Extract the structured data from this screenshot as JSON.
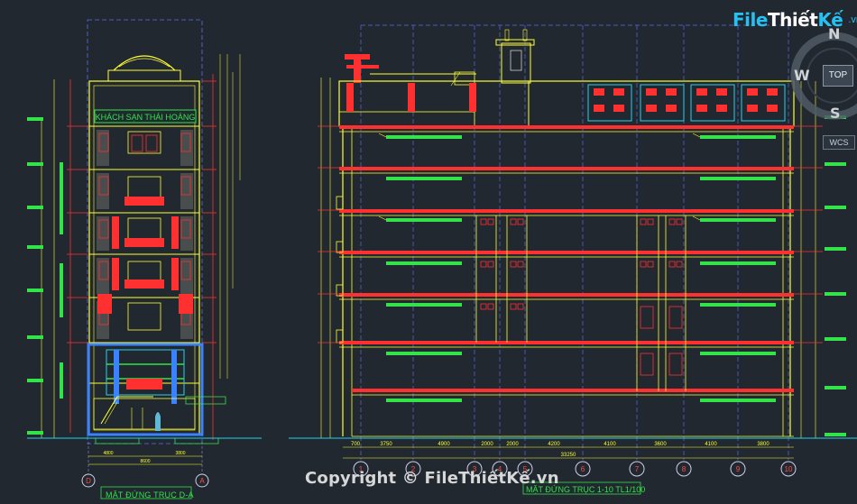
{
  "brand": {
    "part1": "File",
    "part2": "Thiết",
    "part3": "Kế",
    "tld": ".vn"
  },
  "signboard": "KHÁCH SẠN THÁI HOÀNG",
  "copyright": "Copyright © FileThiếtKế.vn",
  "titles": {
    "left": "MẶT ĐỨNG TRỤC D-A",
    "right": "MẶT ĐỨNG TRỤC 1-10 TL1/100"
  },
  "viewcube": {
    "n": "N",
    "w": "W",
    "s": "S",
    "top": "TOP",
    "wcs": "WCS"
  },
  "grid_left": {
    "bubbles": [
      "D",
      "A"
    ],
    "dims": [
      "4800",
      "3800"
    ],
    "total": "8600"
  },
  "grid_right": {
    "bubbles": [
      "1",
      "2",
      "3",
      "4",
      "5",
      "6",
      "7",
      "8",
      "9",
      "10"
    ],
    "dims": [
      "700",
      "3750",
      "4900",
      "2000",
      "2000",
      "4200",
      "4100",
      "3600",
      "4100",
      "3800"
    ],
    "total": "33250"
  },
  "colors": {
    "background": "#212830",
    "line": "#ffff33",
    "slab": "#ff3030",
    "green": "#34e34a",
    "blue": "#3b82ff",
    "cyan": "#22d3ee"
  }
}
